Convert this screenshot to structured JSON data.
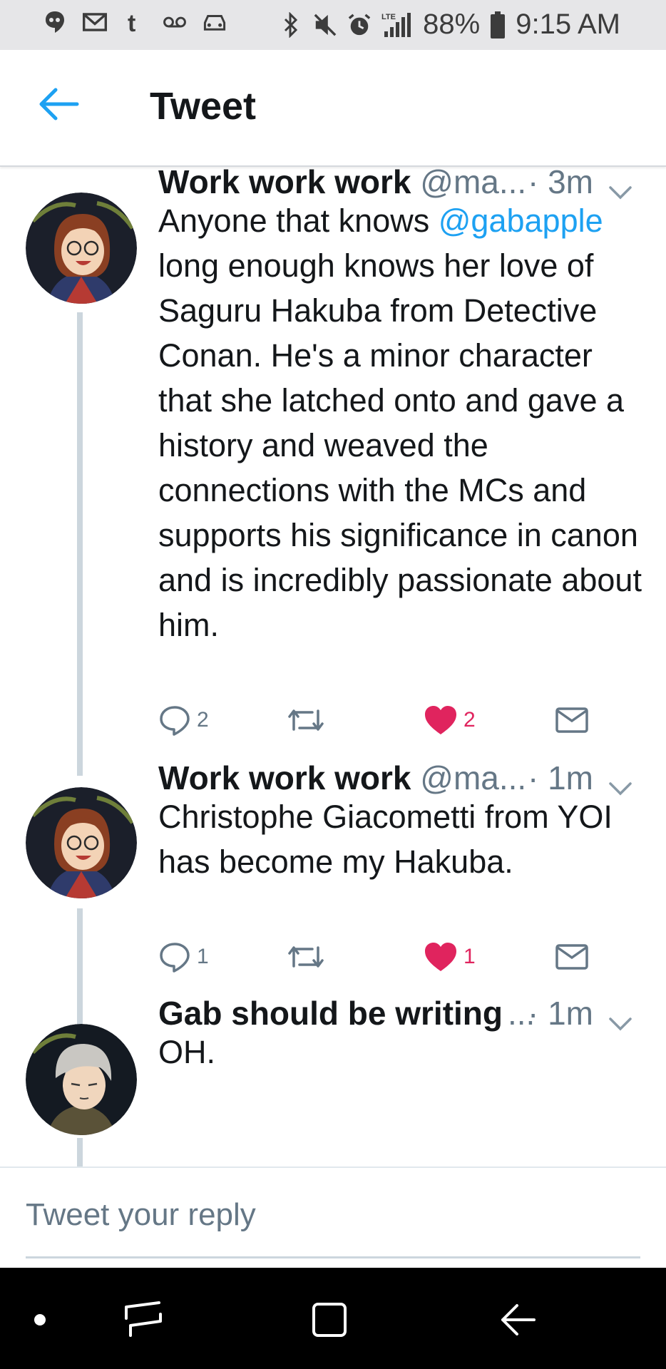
{
  "status_bar": {
    "left_icons": [
      "hangouts-icon",
      "gmail-icon",
      "tumblr-icon",
      "voicemail-icon",
      "car-icon"
    ],
    "right_icons": [
      "bluetooth-icon",
      "mute-icon",
      "alarm-icon",
      "lte-signal-icon"
    ],
    "lte_label": "LTE",
    "battery": "88%",
    "time": "9:15 AM"
  },
  "header": {
    "title": "Tweet"
  },
  "tweets": [
    {
      "name": "Work work work",
      "handle": "@ma...",
      "time": "· 3m",
      "text_prefix": "Anyone that knows ",
      "mention": "@gabapple",
      "text_suffix": " long enough knows her love of Saguru Hakuba from Detective Conan. He's a minor character that she latched onto and gave a history and weaved the connections with the MCs and supports his significance in canon and is incredibly passionate about him.",
      "reply_count": "2",
      "like_count": "2"
    },
    {
      "name": "Work work work",
      "handle": "@ma...",
      "time": "· 1m",
      "text": "Christophe Giacometti from YOI has become my Hakuba.",
      "reply_count": "1",
      "like_count": "1"
    },
    {
      "name": "Gab should be writing",
      "handle": "...",
      "time": "· 1m",
      "text": "OH."
    }
  ],
  "reply": {
    "placeholder": "Tweet your reply"
  },
  "colors": {
    "accent": "#1da1f2",
    "like": "#e0245e",
    "secondary_text": "#657786",
    "thread_line": "#ccd6dd"
  }
}
